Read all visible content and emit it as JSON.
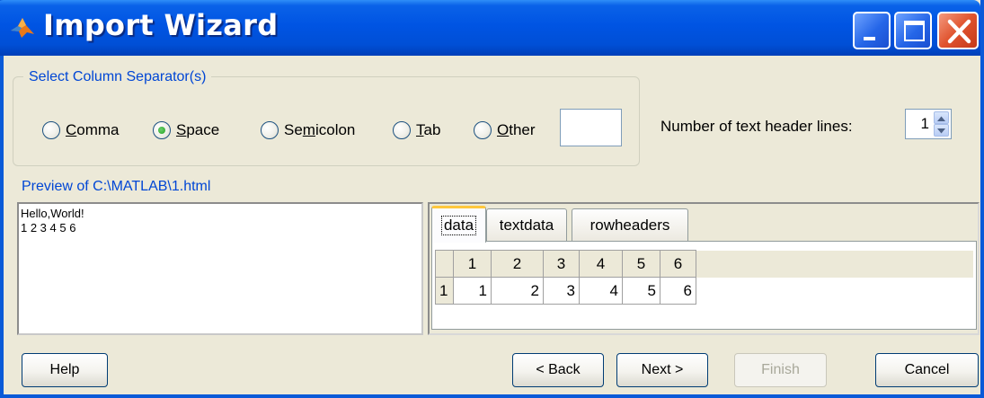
{
  "window": {
    "title": "Import Wizard",
    "icon": "matlab-logo-icon",
    "controls": [
      "minimize-icon",
      "maximize-icon",
      "close-icon"
    ]
  },
  "separators": {
    "legend": "Select Column Separator(s)",
    "options": [
      {
        "label": "Comma",
        "mnemonic": "C",
        "rest": "omma",
        "checked": false
      },
      {
        "label": "Space",
        "mnemonic": "S",
        "rest": "pace",
        "checked": true
      },
      {
        "label": "Semicolon",
        "pre": "Se",
        "mnemonic": "m",
        "rest": "icolon",
        "checked": false
      },
      {
        "label": "Tab",
        "mnemonic": "T",
        "rest": "ab",
        "checked": false
      },
      {
        "label": "Other",
        "mnemonic": "O",
        "rest": "ther",
        "checked": false
      }
    ],
    "other_value": ""
  },
  "header_lines": {
    "label": "Number of text header lines:",
    "value": "1"
  },
  "preview": {
    "label": "Preview of C:\\MATLAB\\1.html",
    "lines": [
      "Hello,World!",
      "1 2 3 4 5 6"
    ]
  },
  "tabs": [
    {
      "label": "data",
      "active": true
    },
    {
      "label": "textdata",
      "active": false
    },
    {
      "label": "rowheaders",
      "active": false
    }
  ],
  "table": {
    "columns": [
      "1",
      "2",
      "3",
      "4",
      "5",
      "6"
    ],
    "rows": [
      {
        "header": "1",
        "cells": [
          "1",
          "2",
          "3",
          "4",
          "5",
          "6"
        ]
      }
    ]
  },
  "buttons": {
    "help": "Help",
    "back": "< Back",
    "next": "Next >",
    "finish": "Finish",
    "cancel": "Cancel"
  },
  "colors": {
    "titlebar": "#0054e3",
    "group_label": "#0046d5",
    "dialog_bg": "#ece9d8"
  }
}
